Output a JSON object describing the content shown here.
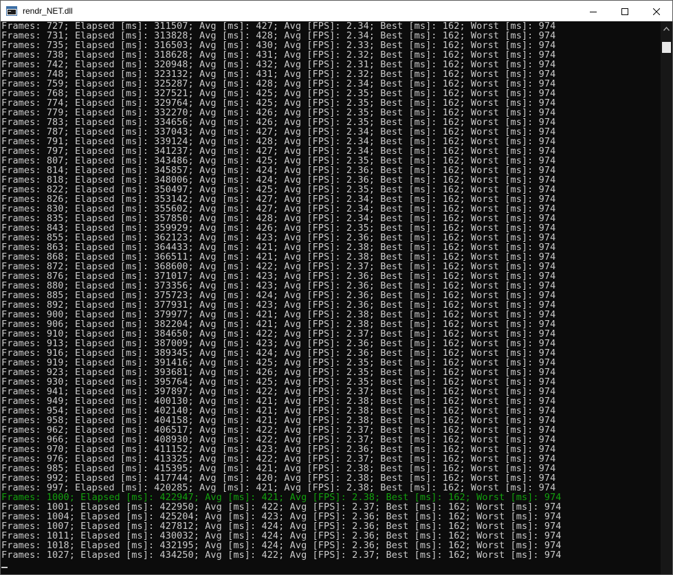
{
  "window": {
    "title": "rendr_NET.dll",
    "icons": {
      "app": "console-window-icon",
      "minimize": "minimize-icon",
      "maximize": "maximize-icon",
      "close": "close-icon",
      "scroll_up": "chevron-up-icon"
    }
  },
  "console": {
    "highlight_color": "#13a10e",
    "text_color": "#cccccc",
    "background": "#0c0c0c",
    "lines": [
      "Frames: 727; Elapsed [ms]: 311507; Avg [ms]: 427; Avg [FPS]: 2.34; Best [ms]: 162; Worst [ms]: 974",
      "Frames: 731; Elapsed [ms]: 313828; Avg [ms]: 428; Avg [FPS]: 2.34; Best [ms]: 162; Worst [ms]: 974",
      "Frames: 735; Elapsed [ms]: 316503; Avg [ms]: 430; Avg [FPS]: 2.33; Best [ms]: 162; Worst [ms]: 974",
      "Frames: 738; Elapsed [ms]: 318628; Avg [ms]: 431; Avg [FPS]: 2.32; Best [ms]: 162; Worst [ms]: 974",
      "Frames: 742; Elapsed [ms]: 320948; Avg [ms]: 432; Avg [FPS]: 2.31; Best [ms]: 162; Worst [ms]: 974",
      "Frames: 748; Elapsed [ms]: 323132; Avg [ms]: 431; Avg [FPS]: 2.32; Best [ms]: 162; Worst [ms]: 974",
      "Frames: 759; Elapsed [ms]: 325287; Avg [ms]: 428; Avg [FPS]: 2.34; Best [ms]: 162; Worst [ms]: 974",
      "Frames: 768; Elapsed [ms]: 327521; Avg [ms]: 425; Avg [FPS]: 2.35; Best [ms]: 162; Worst [ms]: 974",
      "Frames: 774; Elapsed [ms]: 329764; Avg [ms]: 425; Avg [FPS]: 2.35; Best [ms]: 162; Worst [ms]: 974",
      "Frames: 779; Elapsed [ms]: 332270; Avg [ms]: 426; Avg [FPS]: 2.35; Best [ms]: 162; Worst [ms]: 974",
      "Frames: 783; Elapsed [ms]: 334656; Avg [ms]: 426; Avg [FPS]: 2.35; Best [ms]: 162; Worst [ms]: 974",
      "Frames: 787; Elapsed [ms]: 337043; Avg [ms]: 427; Avg [FPS]: 2.34; Best [ms]: 162; Worst [ms]: 974",
      "Frames: 791; Elapsed [ms]: 339124; Avg [ms]: 428; Avg [FPS]: 2.34; Best [ms]: 162; Worst [ms]: 974",
      "Frames: 797; Elapsed [ms]: 341237; Avg [ms]: 427; Avg [FPS]: 2.34; Best [ms]: 162; Worst [ms]: 974",
      "Frames: 807; Elapsed [ms]: 343486; Avg [ms]: 425; Avg [FPS]: 2.35; Best [ms]: 162; Worst [ms]: 974",
      "Frames: 814; Elapsed [ms]: 345857; Avg [ms]: 424; Avg [FPS]: 2.36; Best [ms]: 162; Worst [ms]: 974",
      "Frames: 818; Elapsed [ms]: 348006; Avg [ms]: 424; Avg [FPS]: 2.36; Best [ms]: 162; Worst [ms]: 974",
      "Frames: 822; Elapsed [ms]: 350497; Avg [ms]: 425; Avg [FPS]: 2.35; Best [ms]: 162; Worst [ms]: 974",
      "Frames: 826; Elapsed [ms]: 353142; Avg [ms]: 427; Avg [FPS]: 2.34; Best [ms]: 162; Worst [ms]: 974",
      "Frames: 830; Elapsed [ms]: 355602; Avg [ms]: 427; Avg [FPS]: 2.34; Best [ms]: 162; Worst [ms]: 974",
      "Frames: 835; Elapsed [ms]: 357850; Avg [ms]: 428; Avg [FPS]: 2.34; Best [ms]: 162; Worst [ms]: 974",
      "Frames: 843; Elapsed [ms]: 359929; Avg [ms]: 426; Avg [FPS]: 2.35; Best [ms]: 162; Worst [ms]: 974",
      "Frames: 855; Elapsed [ms]: 362123; Avg [ms]: 423; Avg [FPS]: 2.36; Best [ms]: 162; Worst [ms]: 974",
      "Frames: 863; Elapsed [ms]: 364433; Avg [ms]: 421; Avg [FPS]: 2.38; Best [ms]: 162; Worst [ms]: 974",
      "Frames: 868; Elapsed [ms]: 366511; Avg [ms]: 421; Avg [FPS]: 2.38; Best [ms]: 162; Worst [ms]: 974",
      "Frames: 872; Elapsed [ms]: 368600; Avg [ms]: 422; Avg [FPS]: 2.37; Best [ms]: 162; Worst [ms]: 974",
      "Frames: 876; Elapsed [ms]: 371017; Avg [ms]: 423; Avg [FPS]: 2.36; Best [ms]: 162; Worst [ms]: 974",
      "Frames: 880; Elapsed [ms]: 373356; Avg [ms]: 423; Avg [FPS]: 2.36; Best [ms]: 162; Worst [ms]: 974",
      "Frames: 885; Elapsed [ms]: 375723; Avg [ms]: 424; Avg [FPS]: 2.36; Best [ms]: 162; Worst [ms]: 974",
      "Frames: 892; Elapsed [ms]: 377931; Avg [ms]: 423; Avg [FPS]: 2.36; Best [ms]: 162; Worst [ms]: 974",
      "Frames: 900; Elapsed [ms]: 379977; Avg [ms]: 421; Avg [FPS]: 2.38; Best [ms]: 162; Worst [ms]: 974",
      "Frames: 906; Elapsed [ms]: 382204; Avg [ms]: 421; Avg [FPS]: 2.38; Best [ms]: 162; Worst [ms]: 974",
      "Frames: 910; Elapsed [ms]: 384650; Avg [ms]: 422; Avg [FPS]: 2.37; Best [ms]: 162; Worst [ms]: 974",
      "Frames: 913; Elapsed [ms]: 387009; Avg [ms]: 423; Avg [FPS]: 2.36; Best [ms]: 162; Worst [ms]: 974",
      "Frames: 916; Elapsed [ms]: 389345; Avg [ms]: 424; Avg [FPS]: 2.36; Best [ms]: 162; Worst [ms]: 974",
      "Frames: 919; Elapsed [ms]: 391416; Avg [ms]: 425; Avg [FPS]: 2.35; Best [ms]: 162; Worst [ms]: 974",
      "Frames: 923; Elapsed [ms]: 393681; Avg [ms]: 426; Avg [FPS]: 2.35; Best [ms]: 162; Worst [ms]: 974",
      "Frames: 930; Elapsed [ms]: 395764; Avg [ms]: 425; Avg [FPS]: 2.35; Best [ms]: 162; Worst [ms]: 974",
      "Frames: 941; Elapsed [ms]: 397897; Avg [ms]: 422; Avg [FPS]: 2.37; Best [ms]: 162; Worst [ms]: 974",
      "Frames: 949; Elapsed [ms]: 400130; Avg [ms]: 421; Avg [FPS]: 2.38; Best [ms]: 162; Worst [ms]: 974",
      "Frames: 954; Elapsed [ms]: 402140; Avg [ms]: 421; Avg [FPS]: 2.38; Best [ms]: 162; Worst [ms]: 974",
      "Frames: 958; Elapsed [ms]: 404158; Avg [ms]: 421; Avg [FPS]: 2.38; Best [ms]: 162; Worst [ms]: 974",
      "Frames: 962; Elapsed [ms]: 406517; Avg [ms]: 422; Avg [FPS]: 2.37; Best [ms]: 162; Worst [ms]: 974",
      "Frames: 966; Elapsed [ms]: 408930; Avg [ms]: 422; Avg [FPS]: 2.37; Best [ms]: 162; Worst [ms]: 974",
      "Frames: 970; Elapsed [ms]: 411152; Avg [ms]: 423; Avg [FPS]: 2.36; Best [ms]: 162; Worst [ms]: 974",
      "Frames: 976; Elapsed [ms]: 413325; Avg [ms]: 422; Avg [FPS]: 2.37; Best [ms]: 162; Worst [ms]: 974",
      "Frames: 985; Elapsed [ms]: 415395; Avg [ms]: 421; Avg [FPS]: 2.38; Best [ms]: 162; Worst [ms]: 974",
      "Frames: 992; Elapsed [ms]: 417744; Avg [ms]: 420; Avg [FPS]: 2.38; Best [ms]: 162; Worst [ms]: 974",
      "Frames: 997; Elapsed [ms]: 420285; Avg [ms]: 421; Avg [FPS]: 2.38; Best [ms]: 162; Worst [ms]: 974",
      "Frames: 1000; Elapsed [ms]: 422947; Avg [ms]: 421; Avg [FPS]: 2.38; Best [ms]: 162; Worst [ms]: 974",
      "Frames: 1001; Elapsed [ms]: 422950; Avg [ms]: 422; Avg [FPS]: 2.37; Best [ms]: 162; Worst [ms]: 974",
      "Frames: 1004; Elapsed [ms]: 425204; Avg [ms]: 423; Avg [FPS]: 2.36; Best [ms]: 162; Worst [ms]: 974",
      "Frames: 1007; Elapsed [ms]: 427812; Avg [ms]: 424; Avg [FPS]: 2.36; Best [ms]: 162; Worst [ms]: 974",
      "Frames: 1011; Elapsed [ms]: 430032; Avg [ms]: 424; Avg [FPS]: 2.36; Best [ms]: 162; Worst [ms]: 974",
      "Frames: 1018; Elapsed [ms]: 432195; Avg [ms]: 424; Avg [FPS]: 2.36; Best [ms]: 162; Worst [ms]: 974",
      "Frames: 1027; Elapsed [ms]: 434250; Avg [ms]: 422; Avg [FPS]: 2.37; Best [ms]: 162; Worst [ms]: 974"
    ],
    "highlight_line": 49
  }
}
